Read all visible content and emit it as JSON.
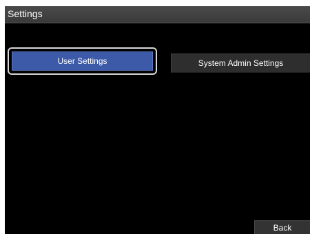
{
  "window": {
    "title": "Settings"
  },
  "tabs": [
    {
      "label": "User Settings",
      "selected": true
    },
    {
      "label": "System Admin Settings",
      "selected": false
    }
  ],
  "footer": {
    "back_label": "Back"
  },
  "colors": {
    "selected_button": "#3c5aa8",
    "unselected_button": "#2e2e2e",
    "background": "#000000",
    "title_bar": "#424242",
    "selection_frame": "#d8d8d8"
  }
}
